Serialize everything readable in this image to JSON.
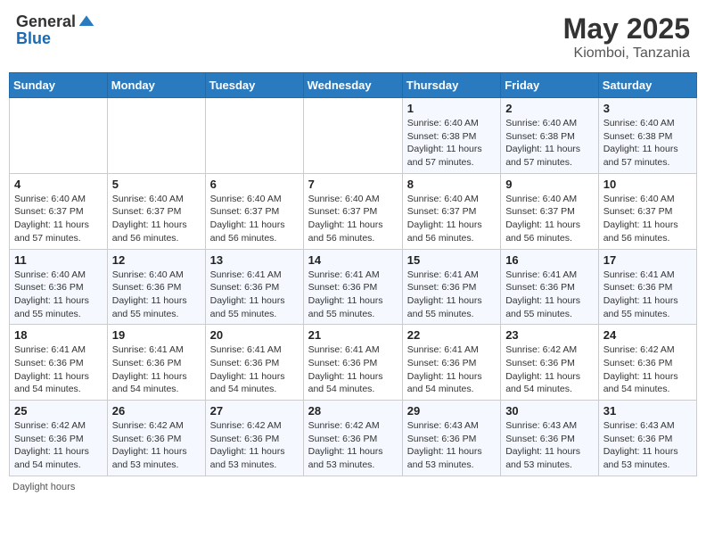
{
  "header": {
    "logo_general": "General",
    "logo_blue": "Blue",
    "title": "May 2025",
    "subtitle": "Kiomboi, Tanzania"
  },
  "days_of_week": [
    "Sunday",
    "Monday",
    "Tuesday",
    "Wednesday",
    "Thursday",
    "Friday",
    "Saturday"
  ],
  "weeks": [
    [
      {
        "day": "",
        "info": ""
      },
      {
        "day": "",
        "info": ""
      },
      {
        "day": "",
        "info": ""
      },
      {
        "day": "",
        "info": ""
      },
      {
        "day": "1",
        "info": "Sunrise: 6:40 AM\nSunset: 6:38 PM\nDaylight: 11 hours\nand 57 minutes."
      },
      {
        "day": "2",
        "info": "Sunrise: 6:40 AM\nSunset: 6:38 PM\nDaylight: 11 hours\nand 57 minutes."
      },
      {
        "day": "3",
        "info": "Sunrise: 6:40 AM\nSunset: 6:38 PM\nDaylight: 11 hours\nand 57 minutes."
      }
    ],
    [
      {
        "day": "4",
        "info": "Sunrise: 6:40 AM\nSunset: 6:37 PM\nDaylight: 11 hours\nand 57 minutes."
      },
      {
        "day": "5",
        "info": "Sunrise: 6:40 AM\nSunset: 6:37 PM\nDaylight: 11 hours\nand 56 minutes."
      },
      {
        "day": "6",
        "info": "Sunrise: 6:40 AM\nSunset: 6:37 PM\nDaylight: 11 hours\nand 56 minutes."
      },
      {
        "day": "7",
        "info": "Sunrise: 6:40 AM\nSunset: 6:37 PM\nDaylight: 11 hours\nand 56 minutes."
      },
      {
        "day": "8",
        "info": "Sunrise: 6:40 AM\nSunset: 6:37 PM\nDaylight: 11 hours\nand 56 minutes."
      },
      {
        "day": "9",
        "info": "Sunrise: 6:40 AM\nSunset: 6:37 PM\nDaylight: 11 hours\nand 56 minutes."
      },
      {
        "day": "10",
        "info": "Sunrise: 6:40 AM\nSunset: 6:37 PM\nDaylight: 11 hours\nand 56 minutes."
      }
    ],
    [
      {
        "day": "11",
        "info": "Sunrise: 6:40 AM\nSunset: 6:36 PM\nDaylight: 11 hours\nand 55 minutes."
      },
      {
        "day": "12",
        "info": "Sunrise: 6:40 AM\nSunset: 6:36 PM\nDaylight: 11 hours\nand 55 minutes."
      },
      {
        "day": "13",
        "info": "Sunrise: 6:41 AM\nSunset: 6:36 PM\nDaylight: 11 hours\nand 55 minutes."
      },
      {
        "day": "14",
        "info": "Sunrise: 6:41 AM\nSunset: 6:36 PM\nDaylight: 11 hours\nand 55 minutes."
      },
      {
        "day": "15",
        "info": "Sunrise: 6:41 AM\nSunset: 6:36 PM\nDaylight: 11 hours\nand 55 minutes."
      },
      {
        "day": "16",
        "info": "Sunrise: 6:41 AM\nSunset: 6:36 PM\nDaylight: 11 hours\nand 55 minutes."
      },
      {
        "day": "17",
        "info": "Sunrise: 6:41 AM\nSunset: 6:36 PM\nDaylight: 11 hours\nand 55 minutes."
      }
    ],
    [
      {
        "day": "18",
        "info": "Sunrise: 6:41 AM\nSunset: 6:36 PM\nDaylight: 11 hours\nand 54 minutes."
      },
      {
        "day": "19",
        "info": "Sunrise: 6:41 AM\nSunset: 6:36 PM\nDaylight: 11 hours\nand 54 minutes."
      },
      {
        "day": "20",
        "info": "Sunrise: 6:41 AM\nSunset: 6:36 PM\nDaylight: 11 hours\nand 54 minutes."
      },
      {
        "day": "21",
        "info": "Sunrise: 6:41 AM\nSunset: 6:36 PM\nDaylight: 11 hours\nand 54 minutes."
      },
      {
        "day": "22",
        "info": "Sunrise: 6:41 AM\nSunset: 6:36 PM\nDaylight: 11 hours\nand 54 minutes."
      },
      {
        "day": "23",
        "info": "Sunrise: 6:42 AM\nSunset: 6:36 PM\nDaylight: 11 hours\nand 54 minutes."
      },
      {
        "day": "24",
        "info": "Sunrise: 6:42 AM\nSunset: 6:36 PM\nDaylight: 11 hours\nand 54 minutes."
      }
    ],
    [
      {
        "day": "25",
        "info": "Sunrise: 6:42 AM\nSunset: 6:36 PM\nDaylight: 11 hours\nand 54 minutes."
      },
      {
        "day": "26",
        "info": "Sunrise: 6:42 AM\nSunset: 6:36 PM\nDaylight: 11 hours\nand 53 minutes."
      },
      {
        "day": "27",
        "info": "Sunrise: 6:42 AM\nSunset: 6:36 PM\nDaylight: 11 hours\nand 53 minutes."
      },
      {
        "day": "28",
        "info": "Sunrise: 6:42 AM\nSunset: 6:36 PM\nDaylight: 11 hours\nand 53 minutes."
      },
      {
        "day": "29",
        "info": "Sunrise: 6:43 AM\nSunset: 6:36 PM\nDaylight: 11 hours\nand 53 minutes."
      },
      {
        "day": "30",
        "info": "Sunrise: 6:43 AM\nSunset: 6:36 PM\nDaylight: 11 hours\nand 53 minutes."
      },
      {
        "day": "31",
        "info": "Sunrise: 6:43 AM\nSunset: 6:36 PM\nDaylight: 11 hours\nand 53 minutes."
      }
    ]
  ],
  "footer": {
    "text": "Daylight hours"
  }
}
